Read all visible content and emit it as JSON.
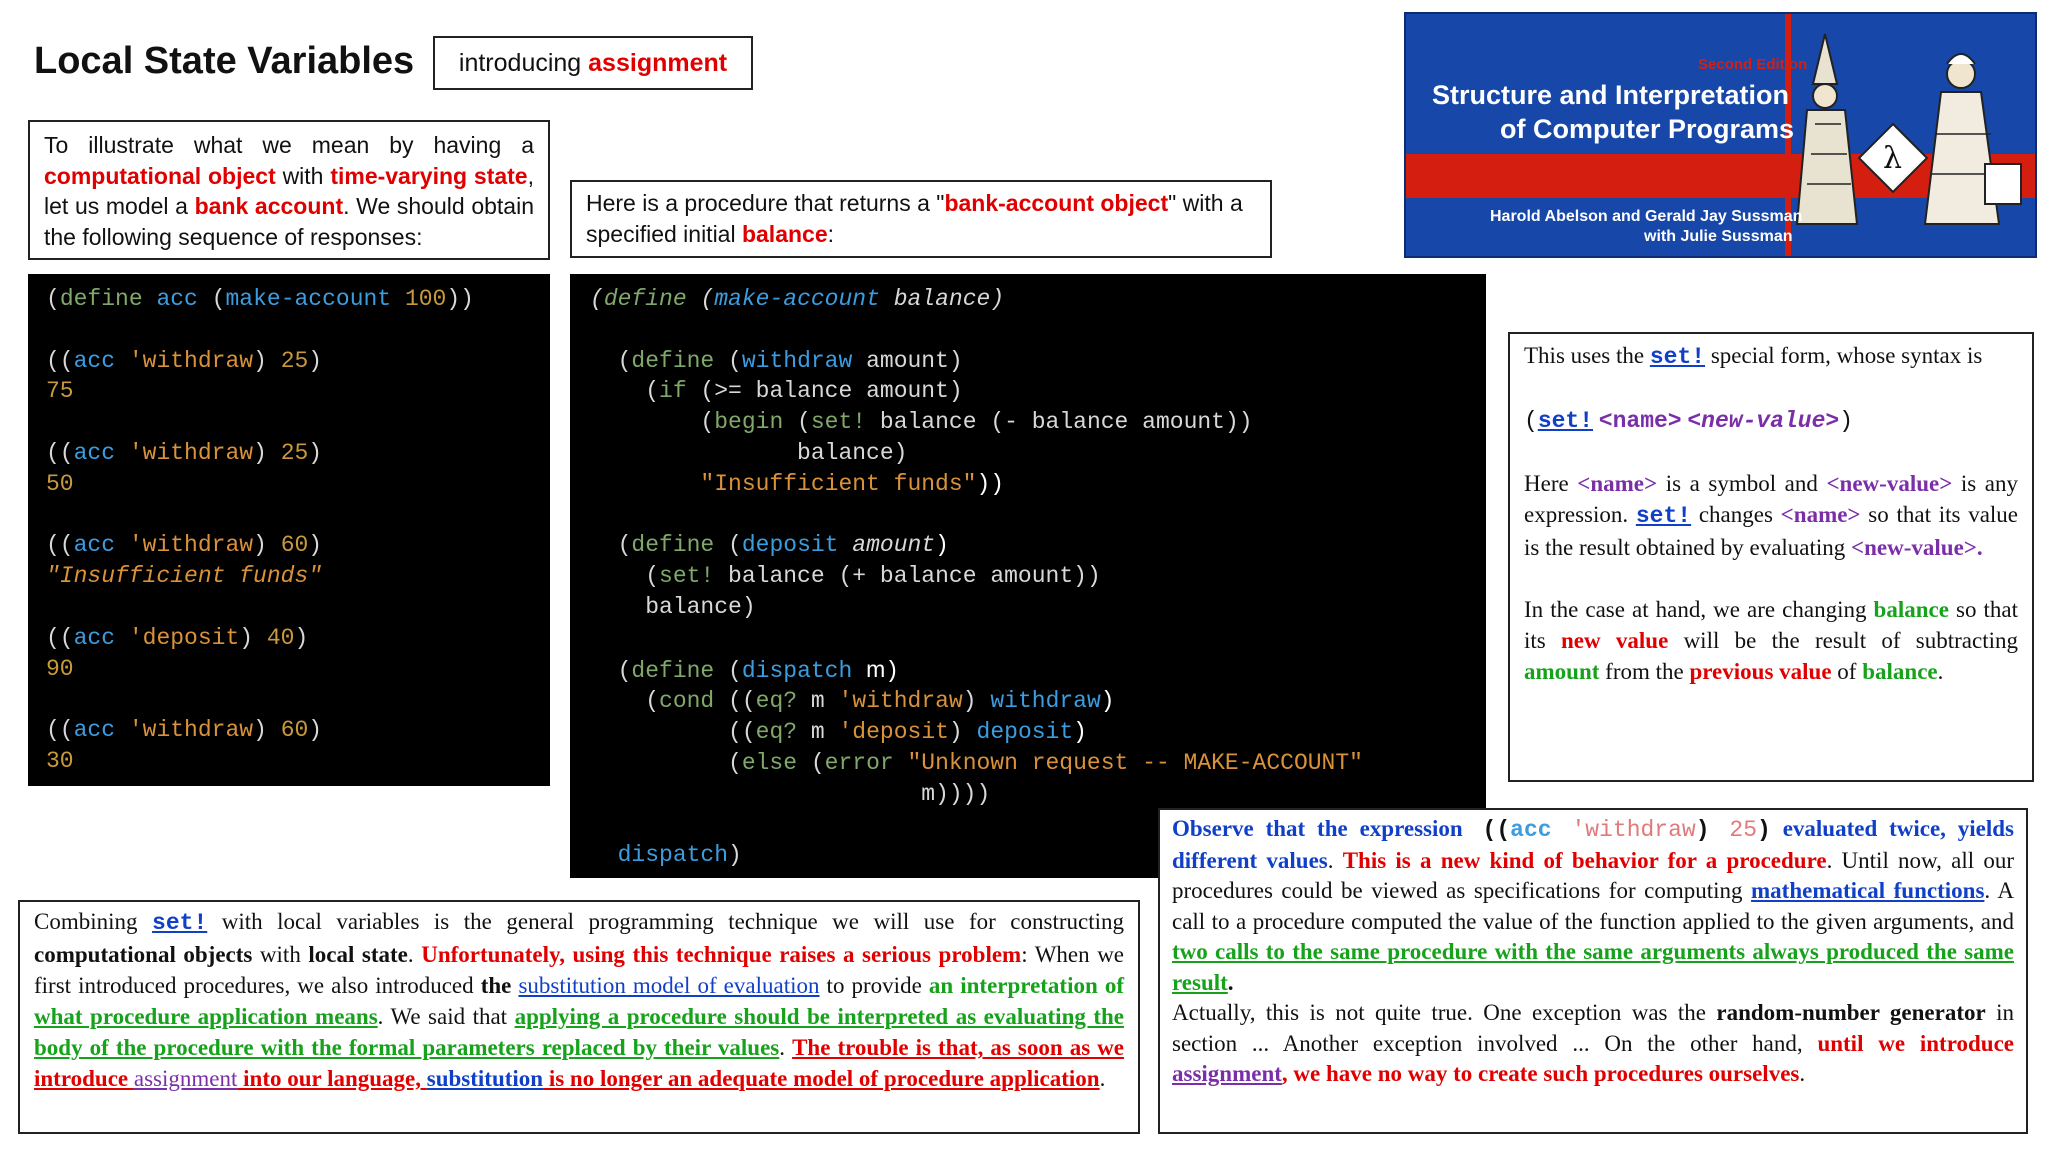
{
  "title": "Local State Variables",
  "tag": {
    "prefix": "introducing ",
    "highlight": "assignment"
  },
  "cover": {
    "edition": "Second Edition",
    "title_line1": "Structure and Interpretation",
    "title_line2": "of Computer Programs",
    "authors_line1": "Harold Abelson and Gerald Jay Sussman",
    "authors_line2": "with Julie Sussman"
  },
  "para1": {
    "t1": "To illustrate what we mean by having a ",
    "h1": "computational object",
    "t2": " with ",
    "h2": "time-varying state",
    "t3": ", let us model a ",
    "h3": "bank account",
    "t4": ". We should obtain the following sequence of responses:"
  },
  "para2": {
    "t1": "Here is a procedure that returns a \"",
    "h1": "bank-account object",
    "t2": "\" with a specified initial ",
    "h2": "balance",
    "t3": ":"
  },
  "code1": {
    "l1": [
      "(",
      "define",
      " ",
      "acc",
      " (",
      "make-account",
      " ",
      "100",
      "))"
    ],
    "l2": [
      "((",
      "acc",
      " ",
      "'withdraw",
      ") ",
      "25",
      ")"
    ],
    "r2": "75",
    "l3": [
      "((",
      "acc",
      " ",
      "'withdraw",
      ") ",
      "25",
      ")"
    ],
    "r3": "50",
    "l4": [
      "((",
      "acc",
      " ",
      "'withdraw",
      ") ",
      "60",
      ")"
    ],
    "r4": "\"Insufficient funds\"",
    "l5": [
      "((",
      "acc",
      " ",
      "'deposit",
      ") ",
      "40",
      ")"
    ],
    "r5": "90",
    "l6": [
      "((",
      "acc",
      " ",
      "'withdraw",
      ") ",
      "60",
      ")"
    ],
    "r6": "30"
  },
  "code2": {
    "define": "define",
    "make_account": "make-account",
    "balance": "balance",
    "withdraw": "withdraw",
    "amount": "amount",
    "if": "if",
    "gte": ">=",
    "begin": "begin",
    "set": "set!",
    "insufficient": "\"Insufficient funds\"",
    "deposit": "deposit",
    "dispatch": "dispatch",
    "m": "m",
    "cond": "cond",
    "eq": "eq?",
    "q_withdraw": "'withdraw",
    "q_deposit": "'deposit",
    "else": "else",
    "error": "error",
    "unknown": "\"Unknown request -- MAKE-ACCOUNT\""
  },
  "para3": {
    "t1": "This uses the ",
    "set": "set!",
    "t2": " special form, whose syntax is",
    "syntax_open": "(",
    "syntax_name": "<name>",
    "syntax_value": "<new-value>",
    "syntax_close": ")",
    "t3": "Here ",
    "t4": " is a symbol and ",
    "t5": " is any expression. ",
    "t6": " changes ",
    "t7": " so that its value is the result obtained by evaluating ",
    "name": "<name>",
    "newvalue": "<new-value>",
    "newvalue_end": "<new-value>.",
    "t8": "In the case at hand, we are changing ",
    "balance": "balance",
    "t9": " so that its ",
    "new_value": "new value",
    "t10": " will be the result of subtracting ",
    "amount": "amount",
    "t11": " from the ",
    "previous_value": "previous value",
    "t12": " of ",
    "balance2": "balance",
    "t13": "."
  },
  "para4": {
    "h1": "Observe that the expression",
    "c_open": " ((",
    "c_acc": "acc",
    "c_withdraw": " 'withdraw",
    "c_close1": ") ",
    "c_25": "25",
    "c_close2": ")",
    "h2": " evaluated twice, yields different values",
    "t1": ". ",
    "r1": "This is a new kind of behavior for a procedure",
    "t2": ". Until now, all our procedures could be viewed as specifications for computing ",
    "mf": "mathematical functions",
    "t3": ". A call to a procedure computed the value of the function applied to the given arguments, and ",
    "g1": "two calls to the same procedure with the same arguments always produced the same result",
    "t4": ".",
    "t5": "Actually, this is not quite true. One exception was the ",
    "rng": "random-number generator",
    "t6": " in section ... Another exception involved ... On the other hand, ",
    "r2": "until we introduce",
    "assignment": "assignment",
    "r3": ", we have no way to create such procedures ourselves",
    "t7": "."
  },
  "para5": {
    "t1": "Combining ",
    "set": "set!",
    "t2": " with local variables is the general programming technique we will use for constructing ",
    "b1": "computational objects",
    "t3": " with ",
    "b2": "local state",
    "t4": ". ",
    "r1": "Unfortunately, using this technique raises a serious problem",
    "t5": ": When we first introduced procedures, we also introduced ",
    "b3": "the",
    "subst": "substitution model of evaluation",
    "t6": " to provide ",
    "g1": "an interpretation of ",
    "g1u": "what procedure application means",
    "t7": ". We said that ",
    "g2": "applying a procedure should be interpreted as evaluating the body of the procedure with the formal parameters replaced by their values",
    "t8": ". ",
    "r2": "The trouble is that, as soon as we introduce ",
    "assignment": "assignment",
    "r3": " into our language, ",
    "subst2": "substitution",
    "r4": " is no longer an adequate model of procedure application",
    "t9": "."
  }
}
